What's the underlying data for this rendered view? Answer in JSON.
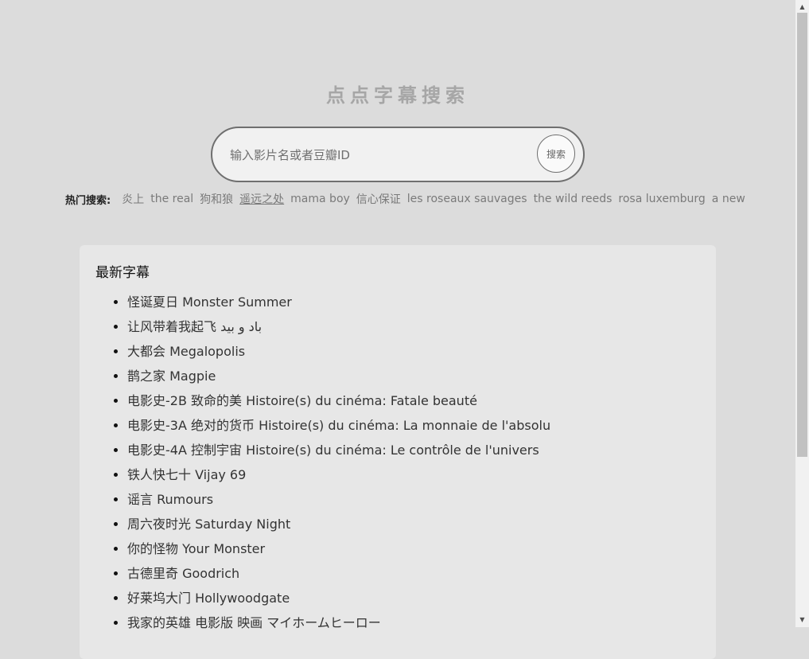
{
  "header": {
    "title": "点点字幕搜索"
  },
  "search": {
    "placeholder": "输入影片名或者豆瓣ID",
    "button_label": "搜索"
  },
  "hot_searches": {
    "label": "热门搜索:",
    "items": [
      "炎上",
      "the real",
      "狗和狼",
      "遥远之处",
      "mama boy",
      "信心保证",
      "les roseaux sauvages",
      "the wild reeds",
      "rosa luxemburg",
      "a new"
    ]
  },
  "latest": {
    "title": "最新字幕",
    "items": [
      "怪诞夏日 Monster Summer",
      "让风带着我起飞 باد و بید",
      "大都会 Megalopolis",
      "鹊之家 Magpie",
      "电影史-2B 致命的美 Histoire(s) du cinéma: Fatale beauté",
      "电影史-3A 绝对的货币 Histoire(s) du cinéma: La monnaie de l'absolu",
      "电影史-4A 控制宇宙 Histoire(s) du cinéma: Le contrôle de l'univers",
      "铁人快七十 Vijay 69",
      "谣言 Rumours",
      "周六夜时光 Saturday Night",
      "你的怪物 Your Monster",
      "古德里奇 Goodrich",
      "好莱坞大门 Hollywoodgate",
      "我家的英雄 电影版 映画 マイホームヒーロー"
    ]
  },
  "scrollbar": {
    "up_icon": "▲",
    "down_icon": "▼"
  }
}
